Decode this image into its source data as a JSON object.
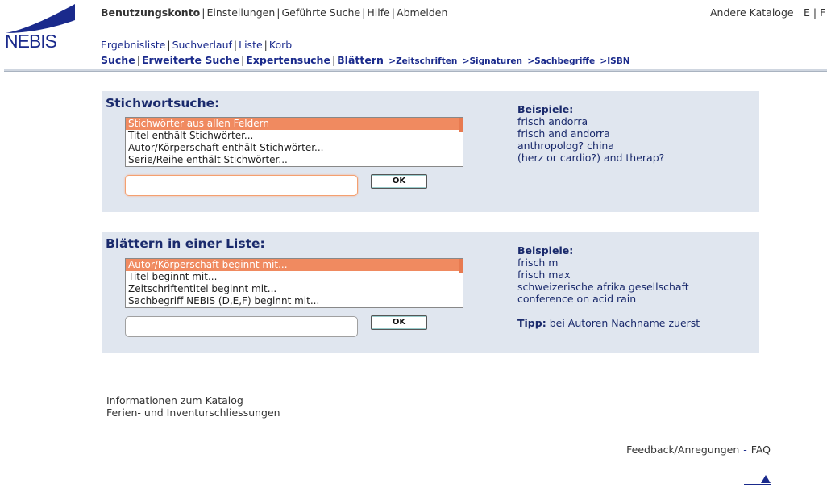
{
  "logo": {
    "text": "NEBIS"
  },
  "topnav": {
    "account": "Benutzungskonto",
    "settings": "Einstellungen",
    "guided": "Geführte Suche",
    "help": "Hilfe",
    "logout": "Abmelden",
    "other_catalogs": "Andere Kataloge",
    "lang_e": "E",
    "lang_f": "F"
  },
  "subnav": {
    "results": "Ergebnisliste",
    "history": "Suchverlauf",
    "list": "Liste",
    "basket": "Korb",
    "search": "Suche",
    "advanced": "Erweiterte Suche",
    "expert": "Expertensuche",
    "browse": "Blättern",
    "journals": ">Zeitschriften",
    "signatures": ">Signaturen",
    "subjects": ">Sachbegriffe",
    "isbn": ">ISBN"
  },
  "keyword_search": {
    "title": "Stichwortsuche:",
    "options": [
      "Stichwörter aus allen Feldern",
      "Titel enthält Stichwörter...",
      "Autor/Körperschaft enthält Stichwörter...",
      "Serie/Reihe enthält Stichwörter..."
    ],
    "selected_index": 0,
    "input_value": "",
    "ok_label": "OK",
    "examples_label": "Beispiele:",
    "examples": [
      "frisch andorra",
      "frisch and andorra",
      "anthropolog? china",
      "(herz or cardio?) and therap?"
    ]
  },
  "browse_list": {
    "title": "Blättern in einer Liste:",
    "options": [
      "Autor/Körperschaft beginnt mit...",
      "Titel beginnt mit...",
      "Zeitschriftentitel beginnt mit...",
      "Sachbegriff NEBIS (D,E,F) beginnt mit..."
    ],
    "selected_index": 0,
    "input_value": "",
    "ok_label": "OK",
    "examples_label": "Beispiele:",
    "examples": [
      "frisch m",
      "frisch max",
      "schweizerische afrika gesellschaft",
      "conference on acid rain"
    ],
    "tip_label": "Tipp:",
    "tip_text": "bei Autoren Nachname zuerst"
  },
  "info": {
    "catalog_info": "Informationen zum Katalog",
    "holidays": "Ferien- und Inventurschliessungen"
  },
  "footer": {
    "feedback": "Feedback/Anregungen",
    "separator": "-",
    "faq": "FAQ"
  },
  "colors": {
    "brand": "#1a2a8c",
    "panel_bg": "#e0e6ef",
    "selection": "#f08a60"
  }
}
